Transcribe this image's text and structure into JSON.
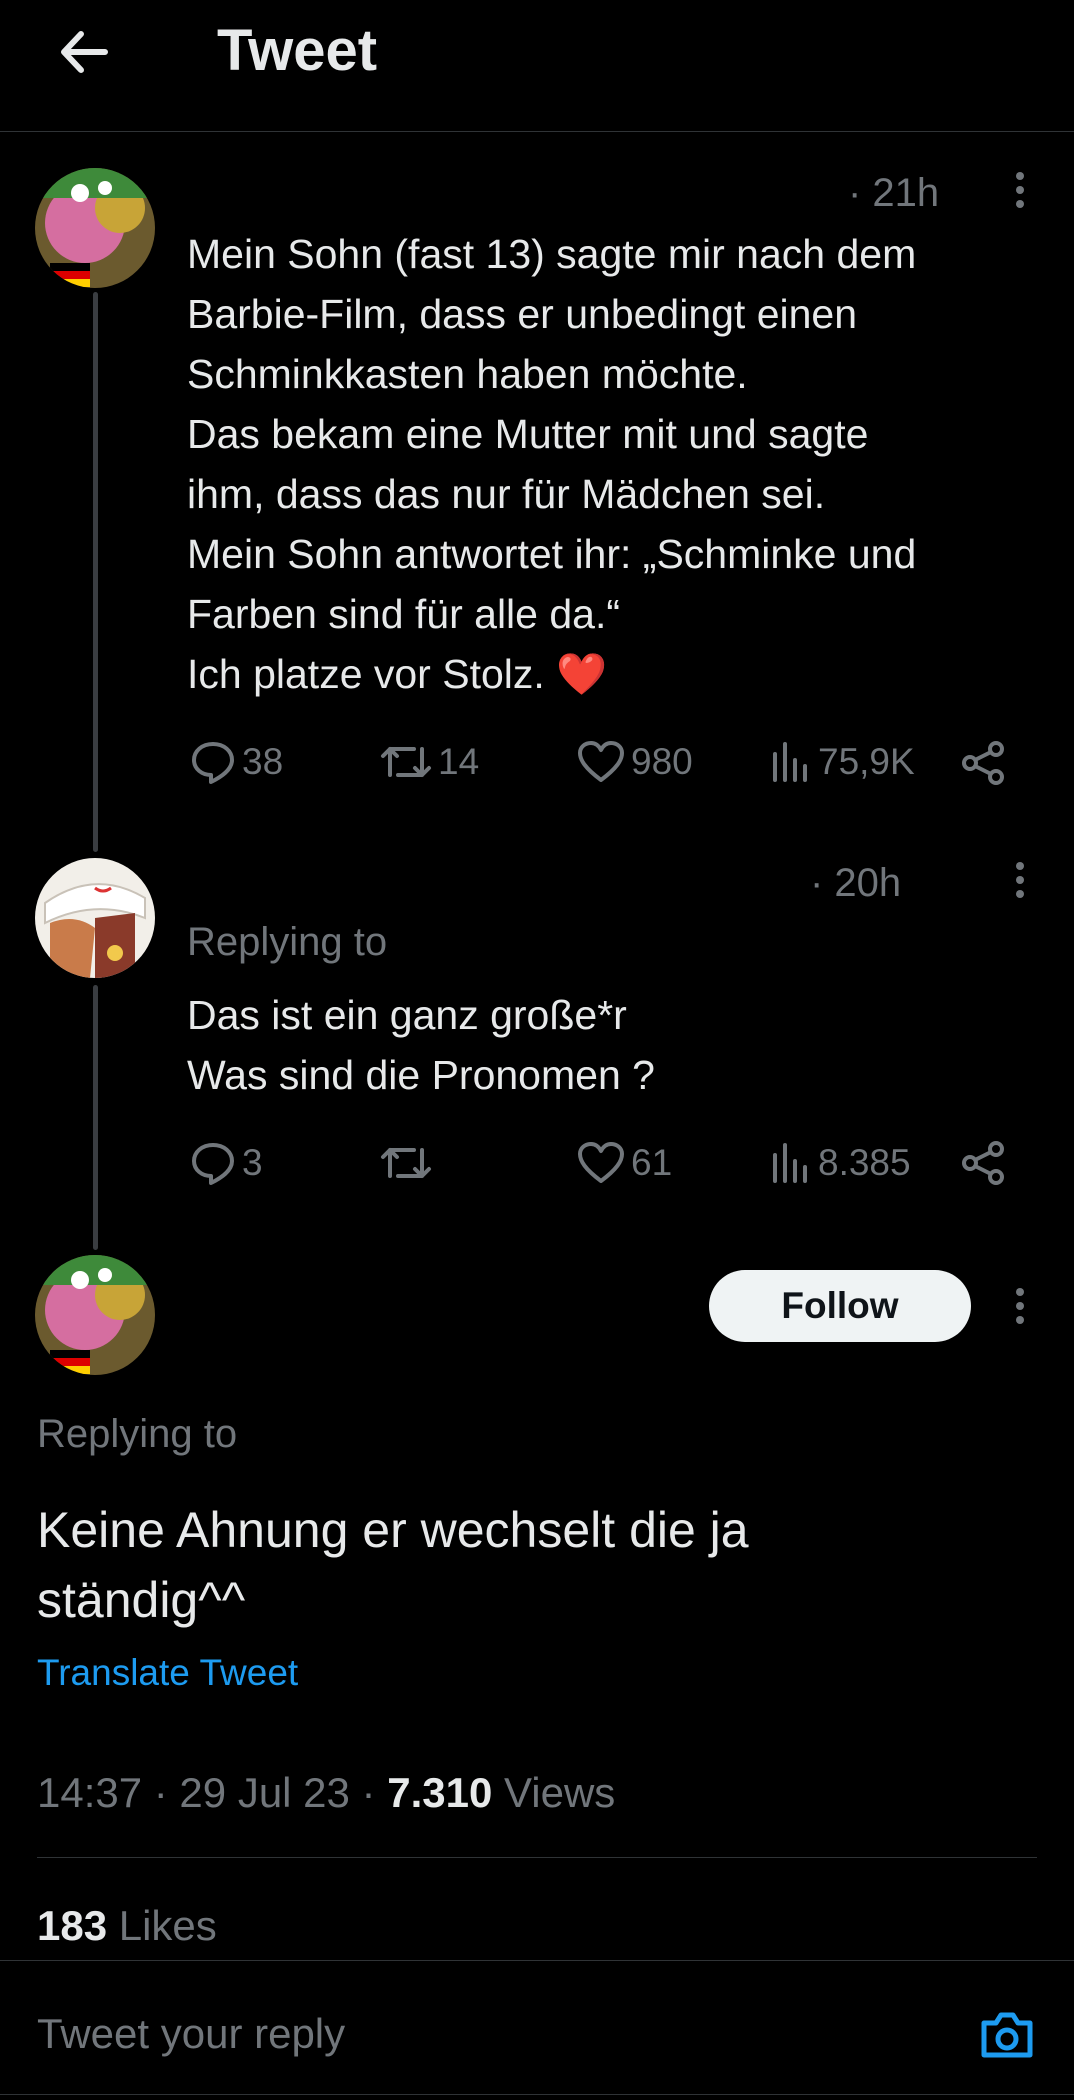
{
  "header": {
    "title": "Tweet"
  },
  "tweets": [
    {
      "time": "· 21h",
      "text": "Mein Sohn (fast 13) sagte mir nach dem\nBarbie-Film, dass er unbedingt einen\nSchminkkasten haben möchte.\nDas bekam eine Mutter mit und sagte\nihm, dass das nur für Mädchen sei.\nMein Sohn antwortet ihr: „Schminke und\nFarben sind für alle da.“\nIch platze vor Stolz. ❤️",
      "stats": {
        "replies": "38",
        "retweets": "14",
        "likes": "980",
        "views": "75,9K"
      }
    },
    {
      "time": "· 20h",
      "replying": "Replying to",
      "text": "Das ist ein ganz große*r\nWas sind die Pronomen ?",
      "stats": {
        "replies": "3",
        "retweets": "",
        "likes": "61",
        "views": "8.385"
      }
    }
  ],
  "main": {
    "follow_label": "Follow",
    "replying": "Replying to",
    "text": "Keine Ahnung er wechselt die ja\nständig^^",
    "translate": "Translate Tweet",
    "time": "14:37 · 29 Jul 23 · ",
    "views_count": "7.310",
    "views_label": " Views",
    "likes_count": "183",
    "likes_label": " Likes"
  },
  "reply_box": {
    "placeholder": "Tweet your reply"
  },
  "colors": {
    "accent": "#1d9bf0",
    "muted": "#71767b",
    "heart": "#e0245e"
  }
}
